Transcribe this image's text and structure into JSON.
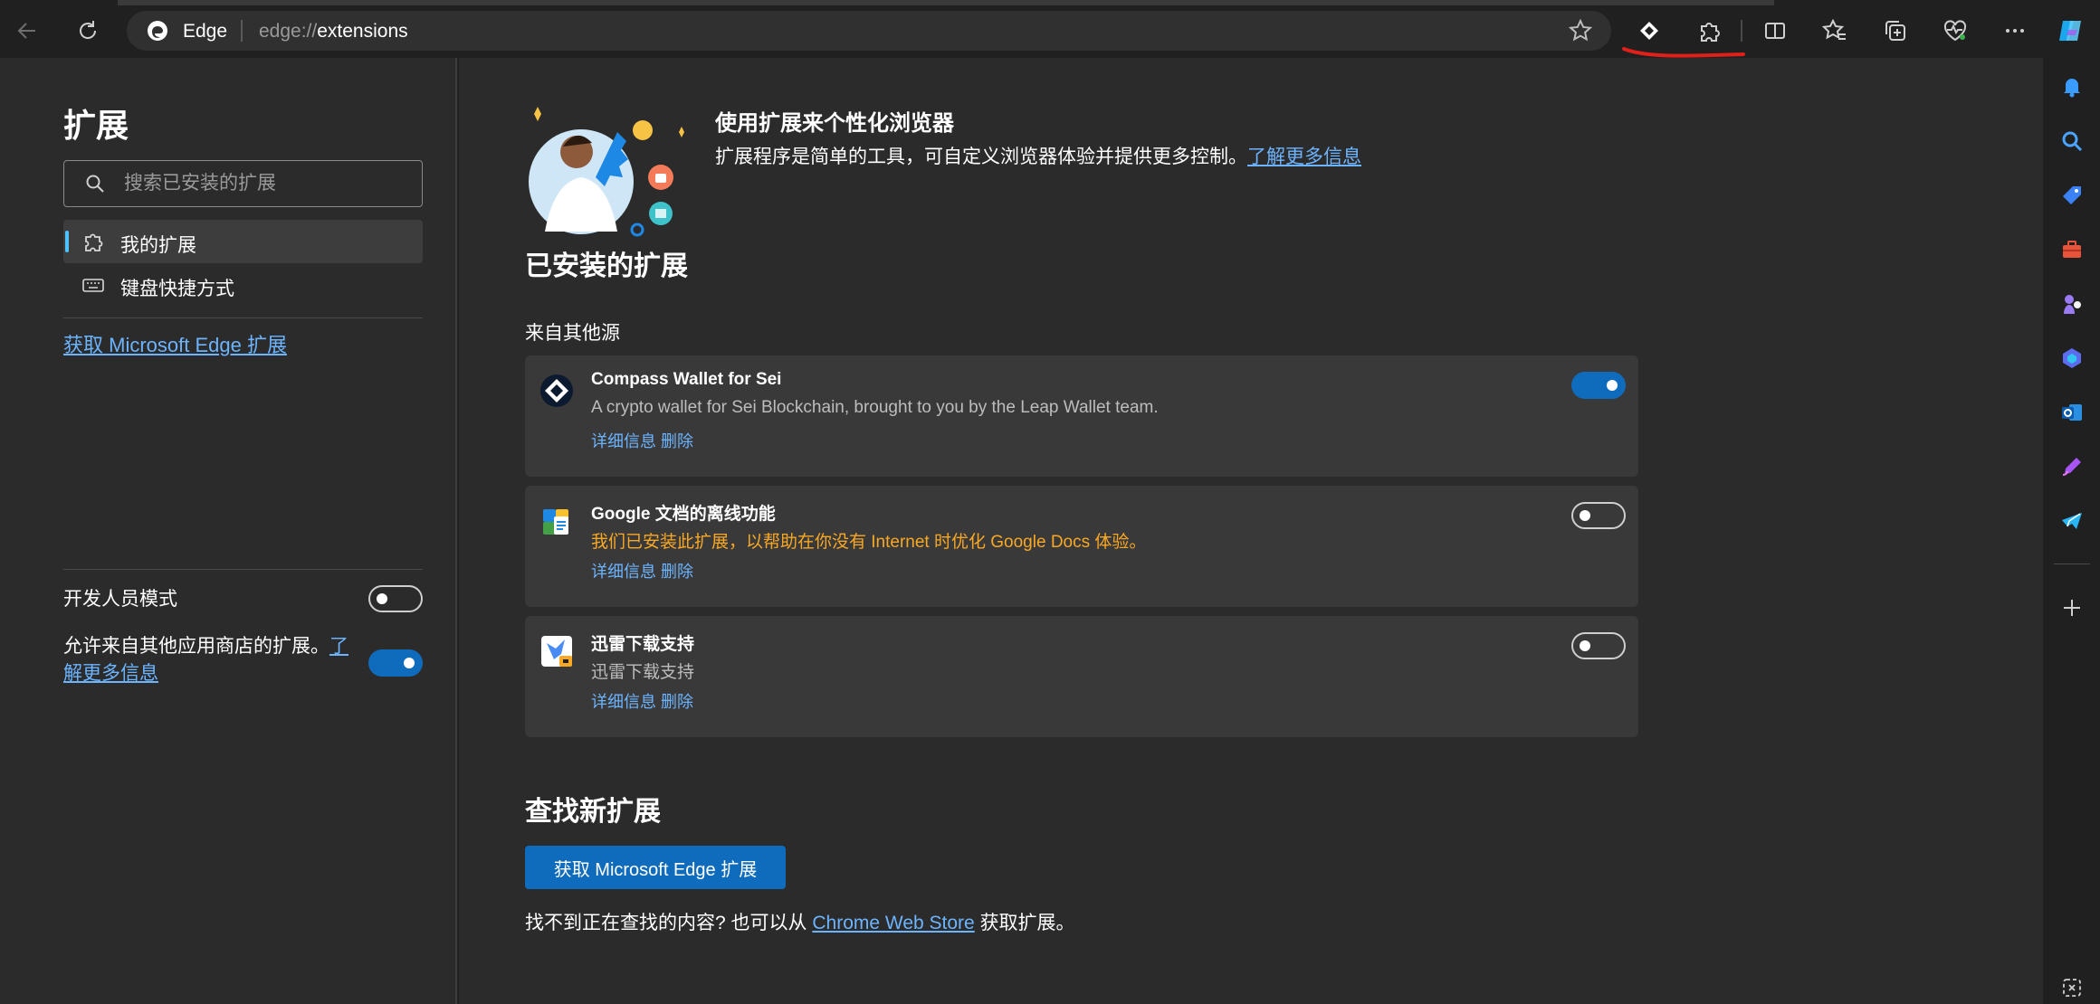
{
  "browser": {
    "site_name": "Edge",
    "url_prefix": "edge://",
    "url_path": "extensions"
  },
  "sidebar": {
    "title": "扩展",
    "search_placeholder": "搜索已安装的扩展",
    "nav": [
      {
        "label": "我的扩展",
        "active": true
      },
      {
        "label": "键盘快捷方式",
        "active": false
      }
    ],
    "get_extensions_link": "获取 Microsoft Edge 扩展",
    "developer_mode_label": "开发人员模式",
    "developer_mode_on": false,
    "allow_other_stores_text": "允许来自其他应用商店的扩展。",
    "allow_other_stores_link": "了解更多信息",
    "allow_other_stores_on": true
  },
  "hero": {
    "title": "使用扩展来个性化浏览器",
    "description": "扩展程序是简单的工具，可自定义浏览器体验并提供更多控制。",
    "learn_more": "了解更多信息"
  },
  "installed": {
    "heading": "已安装的扩展",
    "section_label": "来自其他源",
    "extensions": [
      {
        "name": "Compass Wallet for Sei",
        "description": "A crypto wallet for Sei Blockchain, brought to you by the Leap Wallet team.",
        "details": "详细信息",
        "remove": "删除",
        "enabled": true
      },
      {
        "name": "Google 文档的离线功能",
        "description": "我们已安装此扩展，以帮助在你没有 Internet 时优化 Google Docs 体验。",
        "details": "详细信息",
        "remove": "删除",
        "enabled": false,
        "warning": true
      },
      {
        "name": "迅雷下载支持",
        "description": "迅雷下载支持",
        "details": "详细信息",
        "remove": "删除",
        "enabled": false
      }
    ]
  },
  "find": {
    "heading": "查找新扩展",
    "button": "获取 Microsoft Edge 扩展",
    "text_before": "找不到正在查找的内容? 也可以从",
    "store_link": "Chrome Web Store",
    "text_after": "获取扩展。"
  },
  "colors": {
    "accent_blue": "#0f6cbd",
    "link_blue": "#6cb4ff",
    "warning_orange": "#f9a825",
    "annotation_red": "#e0201a",
    "annotation_blue": "#1e6fe0"
  },
  "icons": {
    "toolbar": [
      "back-icon",
      "refresh-icon",
      "edge-logo-icon",
      "favorite-star-icon",
      "compass-wallet-extension-icon",
      "extensions-puzzle-icon",
      "split-screen-icon",
      "favorites-icon",
      "collections-icon",
      "browser-essentials-icon",
      "more-icon",
      "copilot-icon"
    ],
    "rail": [
      "bell-icon",
      "search-icon",
      "shopping-tag-icon",
      "tools-icon",
      "games-icon",
      "microsoft-365-icon",
      "outlook-icon",
      "designer-icon",
      "telegram-icon",
      "add-icon",
      "screenshot-icon"
    ]
  }
}
